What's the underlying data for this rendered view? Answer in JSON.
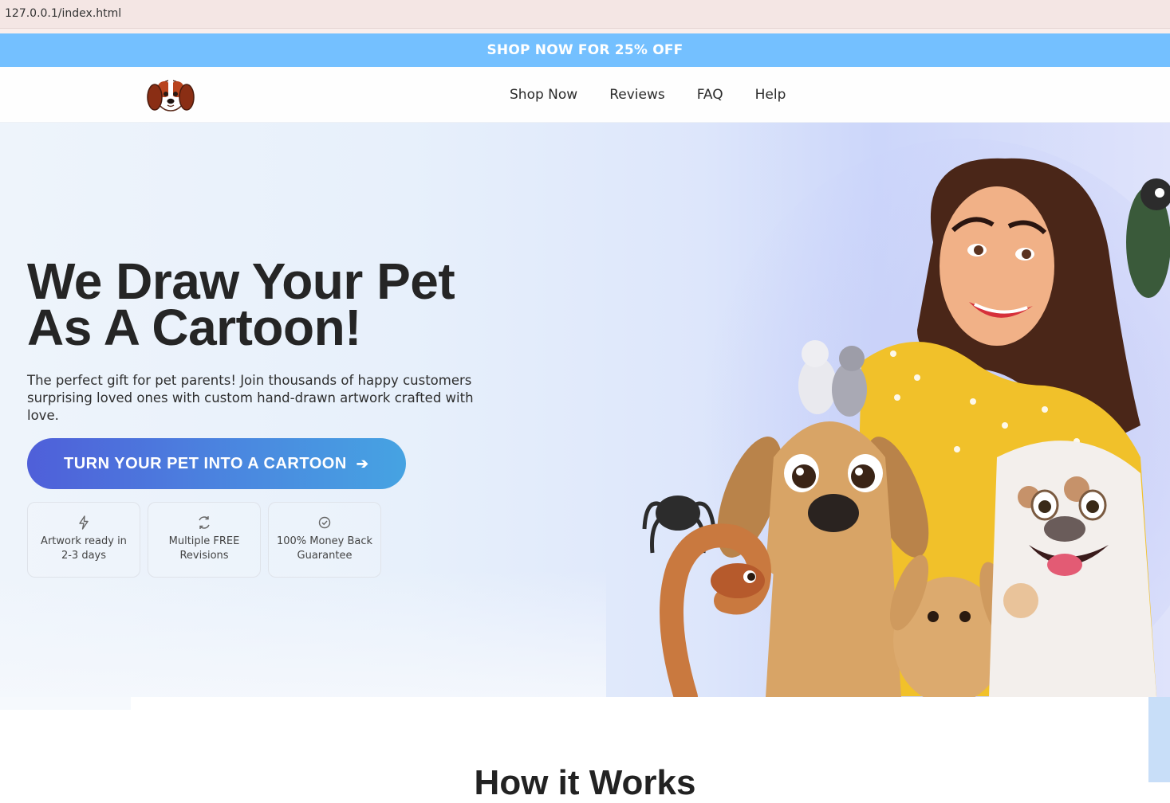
{
  "browser": {
    "url": "127.0.0.1/index.html"
  },
  "promo": {
    "text": "SHOP NOW FOR 25% OFF"
  },
  "nav": {
    "items": [
      "Shop Now",
      "Reviews",
      "FAQ",
      "Help"
    ]
  },
  "hero": {
    "title_line1": "We Draw Your Pet",
    "title_line2": "As A Cartoon!",
    "subtitle": "The perfect gift for pet parents! Join thousands of happy customers surprising loved ones with custom hand-drawn artwork crafted with love.",
    "cta_label": "TURN YOUR PET INTO A CARTOON",
    "features": [
      {
        "icon": "lightning-icon",
        "label": "Artwork ready in 2-3 days"
      },
      {
        "icon": "refresh-icon",
        "label": "Multiple FREE Revisions"
      },
      {
        "icon": "check-circle-icon",
        "label": "100% Money Back Guarantee"
      }
    ]
  },
  "section": {
    "how_title": "How it Works"
  },
  "colors": {
    "promo_bg": "#74c0ff",
    "cta_start": "#4f5fd9",
    "cta_end": "#46a3e2",
    "title": "#252525"
  }
}
